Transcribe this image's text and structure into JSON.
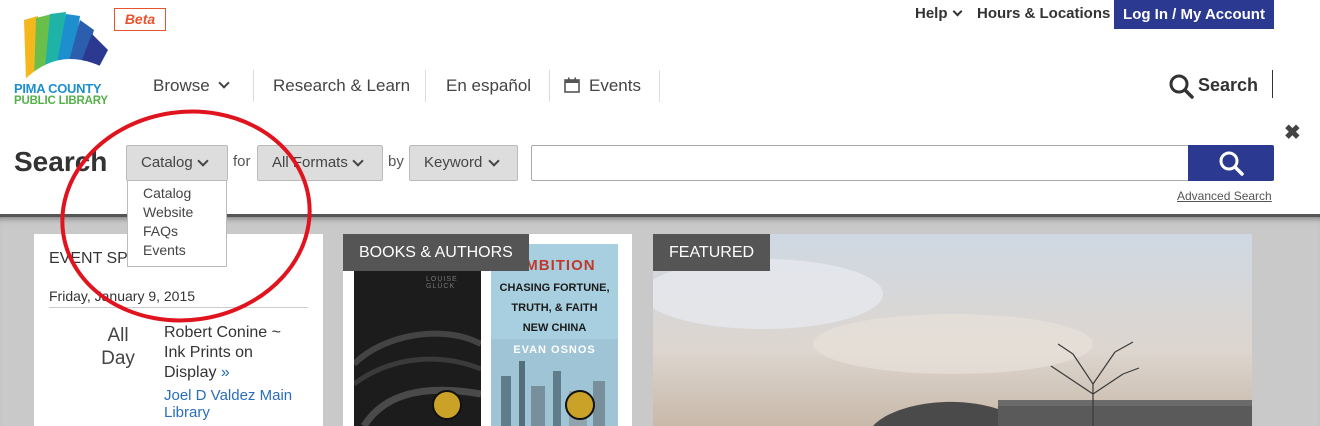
{
  "header": {
    "beta_label": "Beta",
    "logo": {
      "line1": "PIMA COUNTY",
      "line2": "PUBLIC LIBRARY"
    },
    "utility": {
      "help": "Help",
      "hours": "Hours & Locations",
      "login": "Log In / My Account"
    },
    "nav": {
      "browse": "Browse",
      "research": "Research & Learn",
      "espanol": "En español",
      "events": "Events"
    },
    "search_label": "Search"
  },
  "search": {
    "title": "Search",
    "scope_selected": "Catalog",
    "connector_for": "for",
    "format_selected": "All Formats",
    "connector_by": "by",
    "field_selected": "Keyword",
    "query": "",
    "advanced_link": "Advanced Search",
    "close": "✖",
    "scope_options": [
      "Catalog",
      "Website",
      "FAQs",
      "Events"
    ]
  },
  "events_card": {
    "heading": "EVENT SP",
    "date": "Friday, January 9, 2015",
    "time": "All Day",
    "title": "Robert Conine ~ Ink Prints on Display",
    "more": "»",
    "location": "Joel D Valdez Main Library"
  },
  "books_card": {
    "label": "BOOKS & AUTHORS",
    "book1": {
      "author": "LOUISE GLÜCK"
    },
    "book2": {
      "title_word": "AMBITION",
      "line1": "CHASING FORTUNE,",
      "line2": "TRUTH, & FAITH",
      "line3": "NEW CHINA",
      "author": "EVAN OSNOS"
    }
  },
  "featured_card": {
    "label": "FEATURED"
  },
  "colors": {
    "brand_blue": "#2b3990",
    "beta_orange": "#e8532d",
    "annotation_red": "#e0141e",
    "tab_gray": "#555555"
  },
  "icons": [
    "logo-icon",
    "chevron-down-icon",
    "calendar-icon",
    "search-icon",
    "close-icon",
    "medal-icon"
  ]
}
